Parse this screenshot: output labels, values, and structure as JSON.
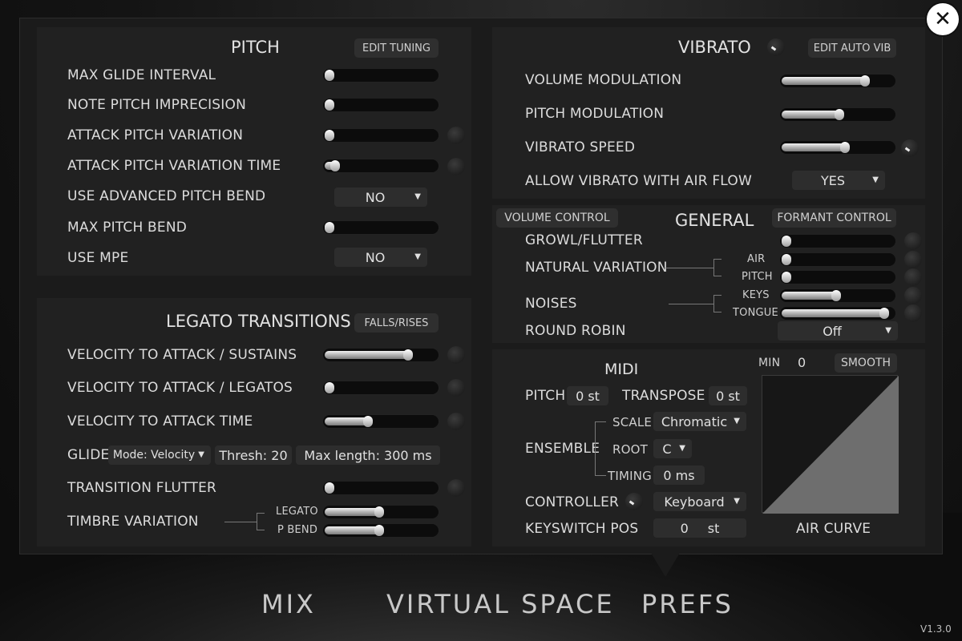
{
  "close_glyph": "✕",
  "pitch": {
    "title": "PITCH",
    "edit_tuning": "EDIT TUNING",
    "max_glide_interval": "MAX GLIDE INTERVAL",
    "note_pitch_imprecision": "NOTE PITCH IMPRECISION",
    "attack_pitch_variation": "ATTACK PITCH VARIATION",
    "attack_pitch_variation_time": "ATTACK PITCH VARIATION TIME",
    "use_advanced_pitch_bend": "USE ADVANCED PITCH BEND",
    "use_advanced_pitch_bend_value": "NO",
    "max_pitch_bend": "MAX PITCH BEND",
    "use_mpe": "USE MPE",
    "use_mpe_value": "NO",
    "levels": {
      "max_glide_interval": 0.05,
      "note_pitch_imprecision": 0.03,
      "attack_pitch_variation": 0.03,
      "attack_pitch_variation_time": 0.12,
      "max_pitch_bend": 0.03
    }
  },
  "legato": {
    "title": "LEGATO TRANSITIONS",
    "falls_rises": "FALLS/RISES",
    "velocity_to_attack_sustains": "VELOCITY TO ATTACK / SUSTAINS",
    "velocity_to_attack_legatos": "VELOCITY TO ATTACK / LEGATOS",
    "velocity_to_attack_time": "VELOCITY TO ATTACK TIME",
    "glide": "GLIDE",
    "glide_mode": "Mode: Velocity",
    "thresh": "Thresh: 20",
    "max_length": "Max length:  300 ms",
    "transition_flutter": "TRANSITION FLUTTER",
    "timbre_variation": "TIMBRE VARIATION",
    "legato_label": "LEGATO",
    "pbend_label": "P BEND",
    "levels": {
      "sustains": 0.78,
      "legatos": 0.03,
      "attack_time": 0.42,
      "transition_flutter": 0.03,
      "legato": 0.52,
      "pbend": 0.52
    }
  },
  "vibrato": {
    "title": "VIBRATO",
    "edit_auto_vib": "EDIT AUTO VIB",
    "volume_modulation": "VOLUME MODULATION",
    "pitch_modulation": "PITCH MODULATION",
    "vibrato_speed": "VIBRATO SPEED",
    "allow_vibrato_with_air_flow": "ALLOW VIBRATO WITH AIR FLOW",
    "allow_value": "YES",
    "levels": {
      "volume_modulation": 0.78,
      "pitch_modulation": 0.55,
      "vibrato_speed": 0.6
    }
  },
  "general": {
    "title": "GENERAL",
    "volume_control": "VOLUME CONTROL",
    "formant_control": "FORMANT CONTROL",
    "growl_flutter": "GROWL/FLUTTER",
    "natural_variation": "NATURAL VARIATION",
    "air": "AIR",
    "pitch": "PITCH",
    "noises": "NOISES",
    "keys": "KEYS",
    "tongue": "TONGUE",
    "round_robin": "ROUND ROBIN",
    "round_robin_value": "Off",
    "levels": {
      "growl_flutter": 0.03,
      "air": 0.03,
      "pitch": 0.03,
      "keys": 0.52,
      "tongue": 0.96
    }
  },
  "midi": {
    "title": "MIDI",
    "pitch": "PITCH",
    "pitch_value": "0 st",
    "transpose": "TRANSPOSE",
    "transpose_value": "0 st",
    "ensemble": "ENSEMBLE",
    "scale": "SCALE",
    "scale_value": "Chromatic",
    "root": "ROOT",
    "root_value": "C",
    "timing": "TIMING",
    "timing_value": "0 ms",
    "controller": "CONTROLLER",
    "controller_value": "Keyboard",
    "keyswitch_pos": "KEYSWITCH POS",
    "keyswitch_value": "0",
    "keyswitch_unit": "st"
  },
  "air_curve": {
    "min_label": "MIN",
    "min_value": "0",
    "smooth": "SMOOTH",
    "title": "AIR CURVE"
  },
  "nav": {
    "mix": "MIX",
    "virtual_space": "VIRTUAL SPACE",
    "prefs": "PREFS"
  },
  "version": "V1.3.0",
  "dropdown_arrow": "▼"
}
